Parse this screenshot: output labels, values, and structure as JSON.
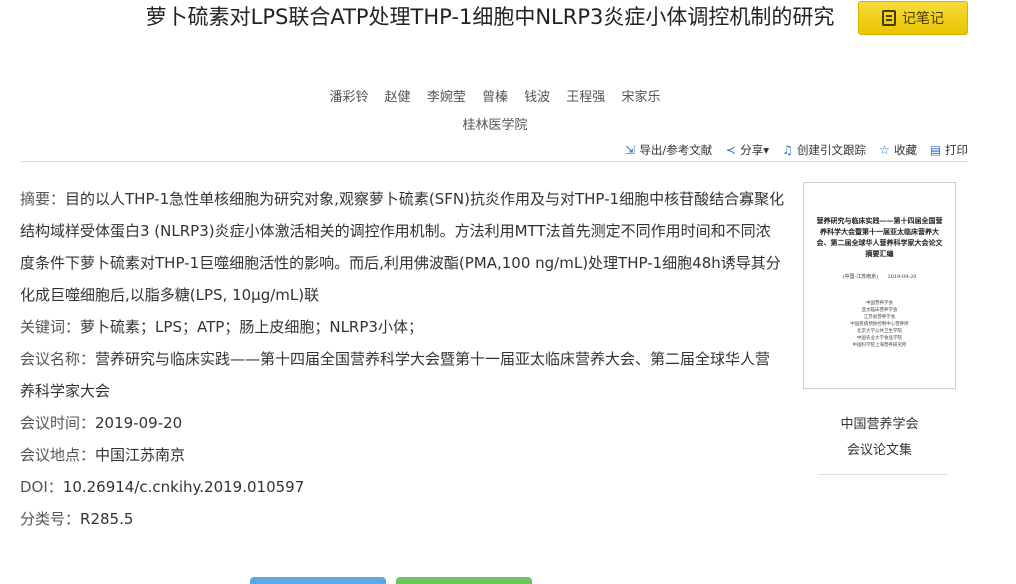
{
  "title": "萝卜硫素对LPS联合ATP处理THP-1细胞中NLRP3炎症小体调控机制的研究",
  "note_button": {
    "label": "记笔记",
    "icon": "notebook-icon"
  },
  "authors": [
    "潘彩铃",
    "赵健",
    "李婉莹",
    "曾榛",
    "钱波",
    "王程强",
    "宋家乐"
  ],
  "institution": "桂林医学院",
  "toolbar": {
    "export": "导出/参考文献",
    "share": "分享▾",
    "track": "创建引文跟踪",
    "favorite": "收藏",
    "print": "打印"
  },
  "abstract": {
    "label": "摘要：",
    "text": "目的以人THP-1急性单核细胞为研究对象,观察萝卜硫素(SFN)抗炎作用及与对THP-1细胞中核苷酸结合寡聚化结构域样受体蛋白3 (NLRP3)炎症小体激活相关的调控作用机制。方法利用MTT法首先测定不同作用时间和不同浓度条件下萝卜硫素对THP-1巨噬细胞活性的影响。而后,利用佛波酯(PMA,100 ng/mL)处理THP-1细胞48h诱导其分化成巨噬细胞后,以脂多糖(LPS, 10μg/mL)联"
  },
  "keywords": {
    "label": "关键词：",
    "items": [
      "萝卜硫素",
      "LPS",
      "ATP",
      "肠上皮细胞",
      "NLRP3小体"
    ]
  },
  "conference": {
    "label": "会议名称：",
    "value": "营养研究与临床实践——第十四届全国营养科学大会暨第十一届亚太临床营养大会、第二届全球华人营养科学家大会"
  },
  "conf_time": {
    "label": "会议时间：",
    "value": "2019-09-20"
  },
  "conf_place": {
    "label": "会议地点：",
    "value": "中国江苏南京"
  },
  "doi": {
    "label": "DOI：",
    "value": "10.26914/c.cnkihy.2019.010597"
  },
  "classification": {
    "label": "分类号：",
    "value": "R285.5"
  },
  "cover": {
    "title": "营养研究与临床实践——第十四届全国营养科学大会暨第十一届亚太临床营养大会、第二届全球华人营养科学家大会论文摘要汇编",
    "date_left": "(中国·江苏南京)",
    "date_right": "2019-09-20",
    "orgs": [
      "中国营养学会",
      "亚太临床营养学会",
      "江苏省营养学会",
      "中国疾病预防控制中心营养所",
      "北京大学公共卫生学院",
      "中国农业大学食品学院",
      "中国科学院上海营养研究所"
    ]
  },
  "publisher": {
    "name": "中国营养学会",
    "type": "会议论文集"
  },
  "colors": {
    "note_button": "#f1cf10",
    "toolbar_icon": "#2a6fc0",
    "blue_button": "#5aa8e6",
    "green_button": "#6cc45a"
  }
}
